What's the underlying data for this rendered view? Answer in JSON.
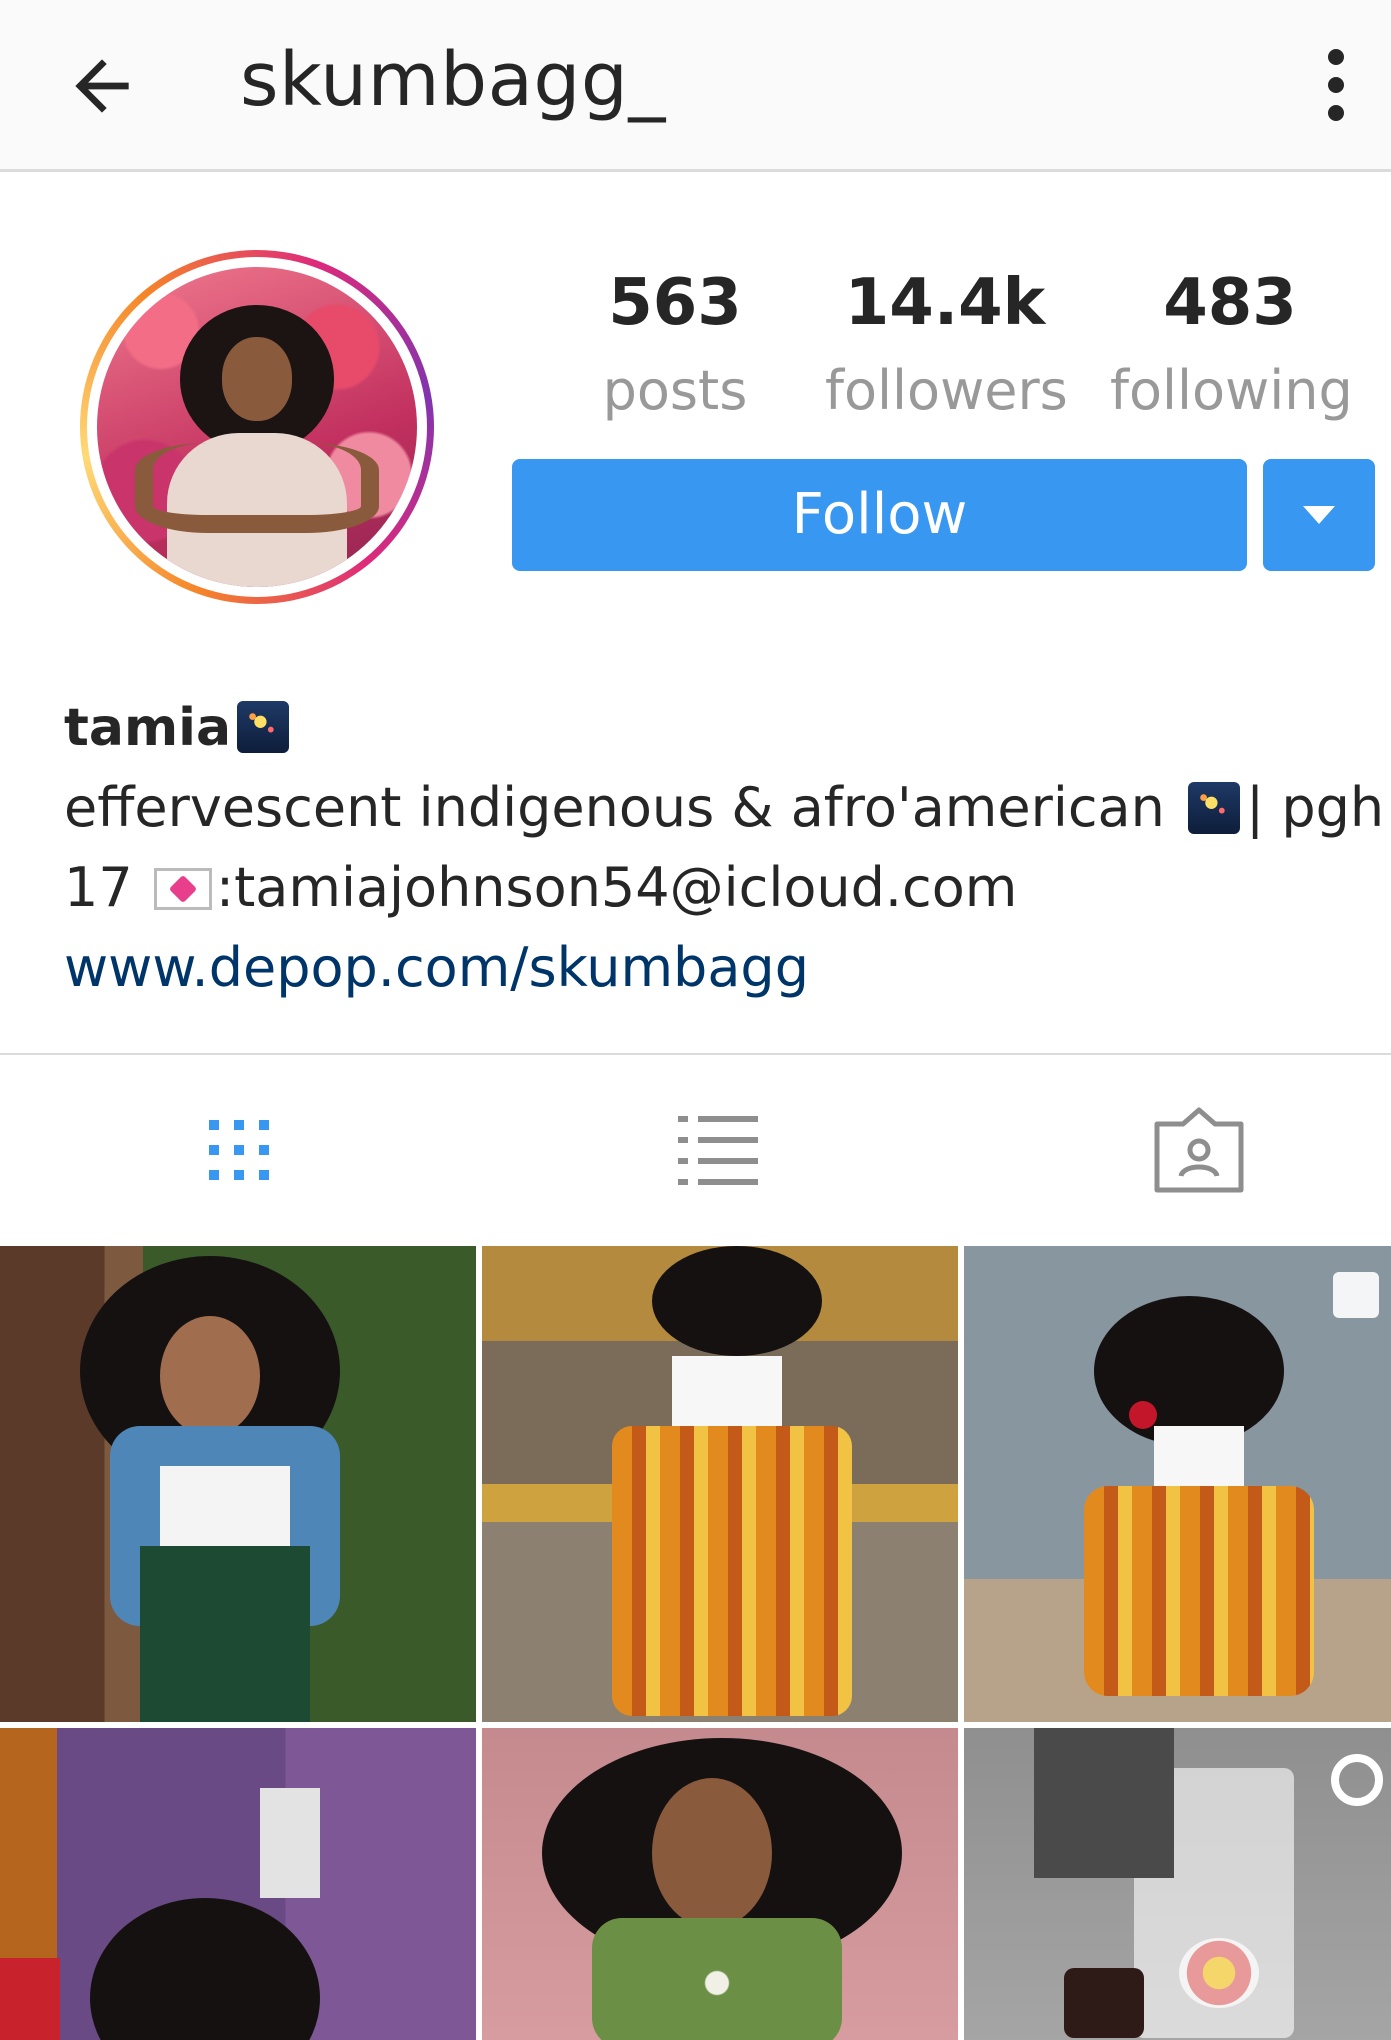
{
  "header": {
    "username": "skumbagg_",
    "back_icon": "arrow-left-icon",
    "more_icon": "more-vertical-icon"
  },
  "stats": {
    "posts_count": "563",
    "posts_label": "posts",
    "followers_count": "14.4k",
    "followers_label": "followers",
    "following_count": "483",
    "following_label": "following"
  },
  "actions": {
    "follow_label": "Follow",
    "accent_color": "#3897f0"
  },
  "bio": {
    "name": "tamia",
    "line1_text": "effervescent indigenous & afro'american",
    "line1_suffix": "| pgh |",
    "line2_prefix": "17",
    "line2_email": ":tamiajohnson54@icloud.com",
    "website": "www.depop.com/skumbagg",
    "emoji_icons": [
      "night-with-stars-icon",
      "love-letter-icon"
    ]
  },
  "tabs": [
    {
      "name": "grid",
      "icon": "grid-icon",
      "active": true
    },
    {
      "name": "list",
      "icon": "list-icon",
      "active": false
    },
    {
      "name": "tagged",
      "icon": "tagged-icon",
      "active": false
    }
  ],
  "grid": {
    "photo_count_visible": 6,
    "badges": [
      "gallery-icon",
      "video-icon"
    ]
  }
}
